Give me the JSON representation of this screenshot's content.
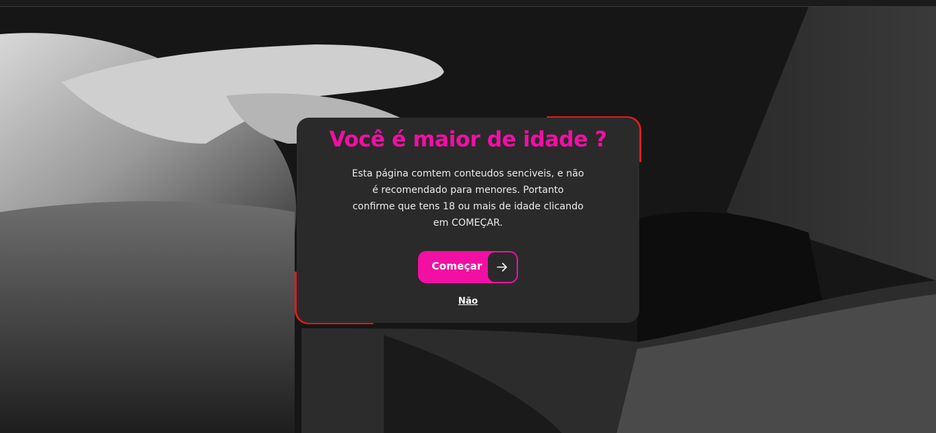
{
  "modal": {
    "title": "Você é maior de idade ?",
    "description": "Esta página comtem conteudos senciveis, e não é recomendado para menores. Portanto confirme que tens 18 ou mais de idade clicando em COMEÇAR.",
    "start_button": {
      "label": "Começar",
      "icon": "arrow-right-icon"
    },
    "decline_link": "Não"
  },
  "colors": {
    "accent": "#f20fa3",
    "frame": "#e01b1b",
    "modal_bg": "#2a2a2b"
  }
}
